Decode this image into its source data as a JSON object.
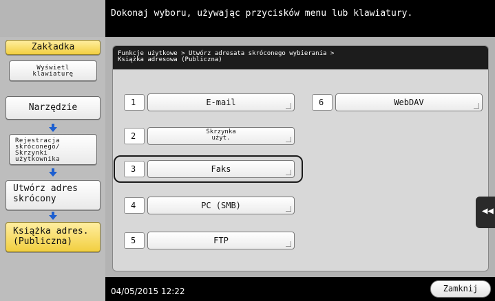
{
  "header": {
    "message": "Dokonaj wyboru, używając przycisków menu lub klawiatury."
  },
  "sidebar": {
    "tab_label": "Zakładka",
    "show_keyboard": [
      "Wyświetl",
      "klawiaturę"
    ],
    "tool_label": "Narzędzie",
    "steps": [
      [
        "Rejestracja",
        "skróconego/",
        "Skrzynki",
        "użytkownika"
      ],
      [
        "Utwórz adres",
        "skrócony"
      ],
      [
        "Książka adres.",
        "(Publiczna)"
      ]
    ]
  },
  "breadcrumb": {
    "line1": "Funkcje użytkowe > Utwórz adresata skróconego wybierania >",
    "line2": "Książka adresowa (Publiczna)"
  },
  "destinations": [
    {
      "num": "1",
      "label": "E-mail"
    },
    {
      "num": "2",
      "label": [
        "Skrzynka",
        "użyt."
      ]
    },
    {
      "num": "3",
      "label": "Faks"
    },
    {
      "num": "4",
      "label": "PC (SMB)"
    },
    {
      "num": "5",
      "label": "FTP"
    },
    {
      "num": "6",
      "label": "WebDAV"
    }
  ],
  "back_tab": {
    "glyph": "◀◀"
  },
  "footer": {
    "datetime": "04/05/2015  12:22",
    "close_label": "Zamknij"
  },
  "colors": {
    "accent_yellow": "#f2cf40",
    "arrow_blue": "#1d5fd0"
  }
}
